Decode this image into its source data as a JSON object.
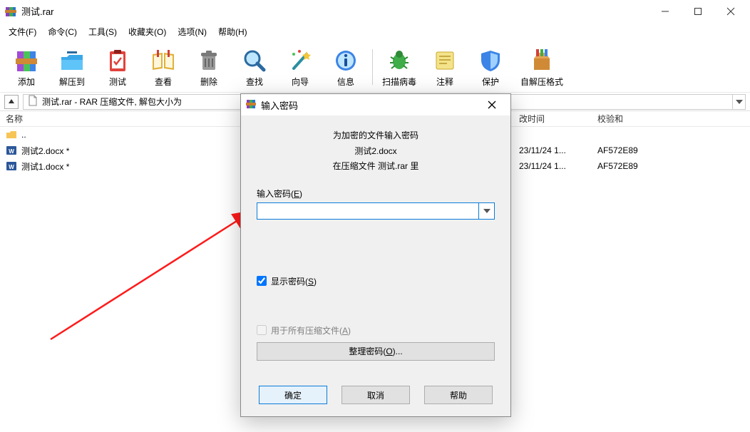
{
  "window": {
    "title": "测试.rar"
  },
  "menu": {
    "file": "文件(F)",
    "command": "命令(C)",
    "tools": "工具(S)",
    "fav": "收藏夹(O)",
    "options": "选项(N)",
    "help": "帮助(H)"
  },
  "toolbar": {
    "add": "添加",
    "extract": "解压到",
    "test": "测试",
    "view": "查看",
    "delete": "删除",
    "find": "查找",
    "wizard": "向导",
    "info": "信息",
    "virus": "扫描病毒",
    "comment": "注释",
    "protect": "保护",
    "sfx": "自解压格式"
  },
  "path": {
    "text": "测试.rar - RAR 压缩文件, 解包大小为"
  },
  "columns": {
    "name": "名称",
    "size": "",
    "packed": "",
    "type": "",
    "time": "改时间",
    "crc": "校验和"
  },
  "files": [
    {
      "name": "..",
      "kind": "folder",
      "size": "",
      "packed": "",
      "type": "",
      "time": "",
      "crc": ""
    },
    {
      "name": "测试2.docx *",
      "kind": "docx",
      "size": "",
      "packed": "",
      "type": "",
      "time": "23/11/24 1...",
      "crc": "AF572E89"
    },
    {
      "name": "测试1.docx *",
      "kind": "docx",
      "size": "",
      "packed": "",
      "type": "",
      "time": "23/11/24 1...",
      "crc": "AF572E89"
    }
  ],
  "dialog": {
    "title": "输入密码",
    "line1": "为加密的文件输入密码",
    "line2": "测试2.docx",
    "line3": "在压缩文件 测试.rar 里",
    "input_label_a": "输入密码(",
    "input_label_u": "E",
    "input_label_b": ")",
    "password_value": "",
    "show_pw_a": "显示密码(",
    "show_pw_u": "S",
    "show_pw_b": ")",
    "use_all_a": "用于所有压缩文件(",
    "use_all_u": "A",
    "use_all_b": ")",
    "organize_a": "整理密码(",
    "organize_u": "O",
    "organize_b": ")...",
    "ok": "确定",
    "cancel": "取消",
    "help": "帮助"
  }
}
